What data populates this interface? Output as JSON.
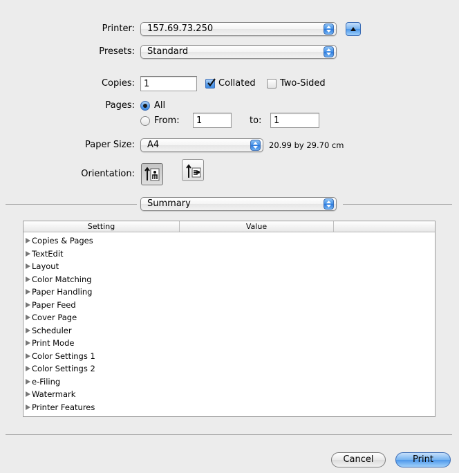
{
  "printer": {
    "label": "Printer:",
    "value": "157.69.73.250"
  },
  "presets": {
    "label": "Presets:",
    "value": "Standard"
  },
  "copies": {
    "label": "Copies:",
    "value": "1",
    "collated_label": "Collated",
    "collated": true,
    "two_sided_label": "Two-Sided",
    "two_sided": false
  },
  "pages": {
    "label": "Pages:",
    "all_label": "All",
    "from_label": "From:",
    "from_value": "1",
    "to_label": "to:",
    "to_value": "1",
    "selected": "All"
  },
  "paper_size": {
    "label": "Paper Size:",
    "value": "A4",
    "dimensions": "20.99 by 29.70 cm"
  },
  "orientation": {
    "label": "Orientation:",
    "selected": "portrait"
  },
  "panel": {
    "value": "Summary"
  },
  "table": {
    "headers": [
      "Setting",
      "Value"
    ],
    "rows": [
      "Copies & Pages",
      "TextEdit",
      "Layout",
      "Color Matching",
      "Paper Handling",
      "Paper Feed",
      "Cover Page",
      "Scheduler",
      "Print Mode",
      "Color Settings 1",
      "Color Settings 2",
      "e-Filing",
      "Watermark",
      "Printer Features"
    ]
  },
  "buttons": {
    "cancel": "Cancel",
    "print": "Print"
  },
  "colors": {
    "background": "#ececec",
    "accent": "#4c97ea"
  }
}
